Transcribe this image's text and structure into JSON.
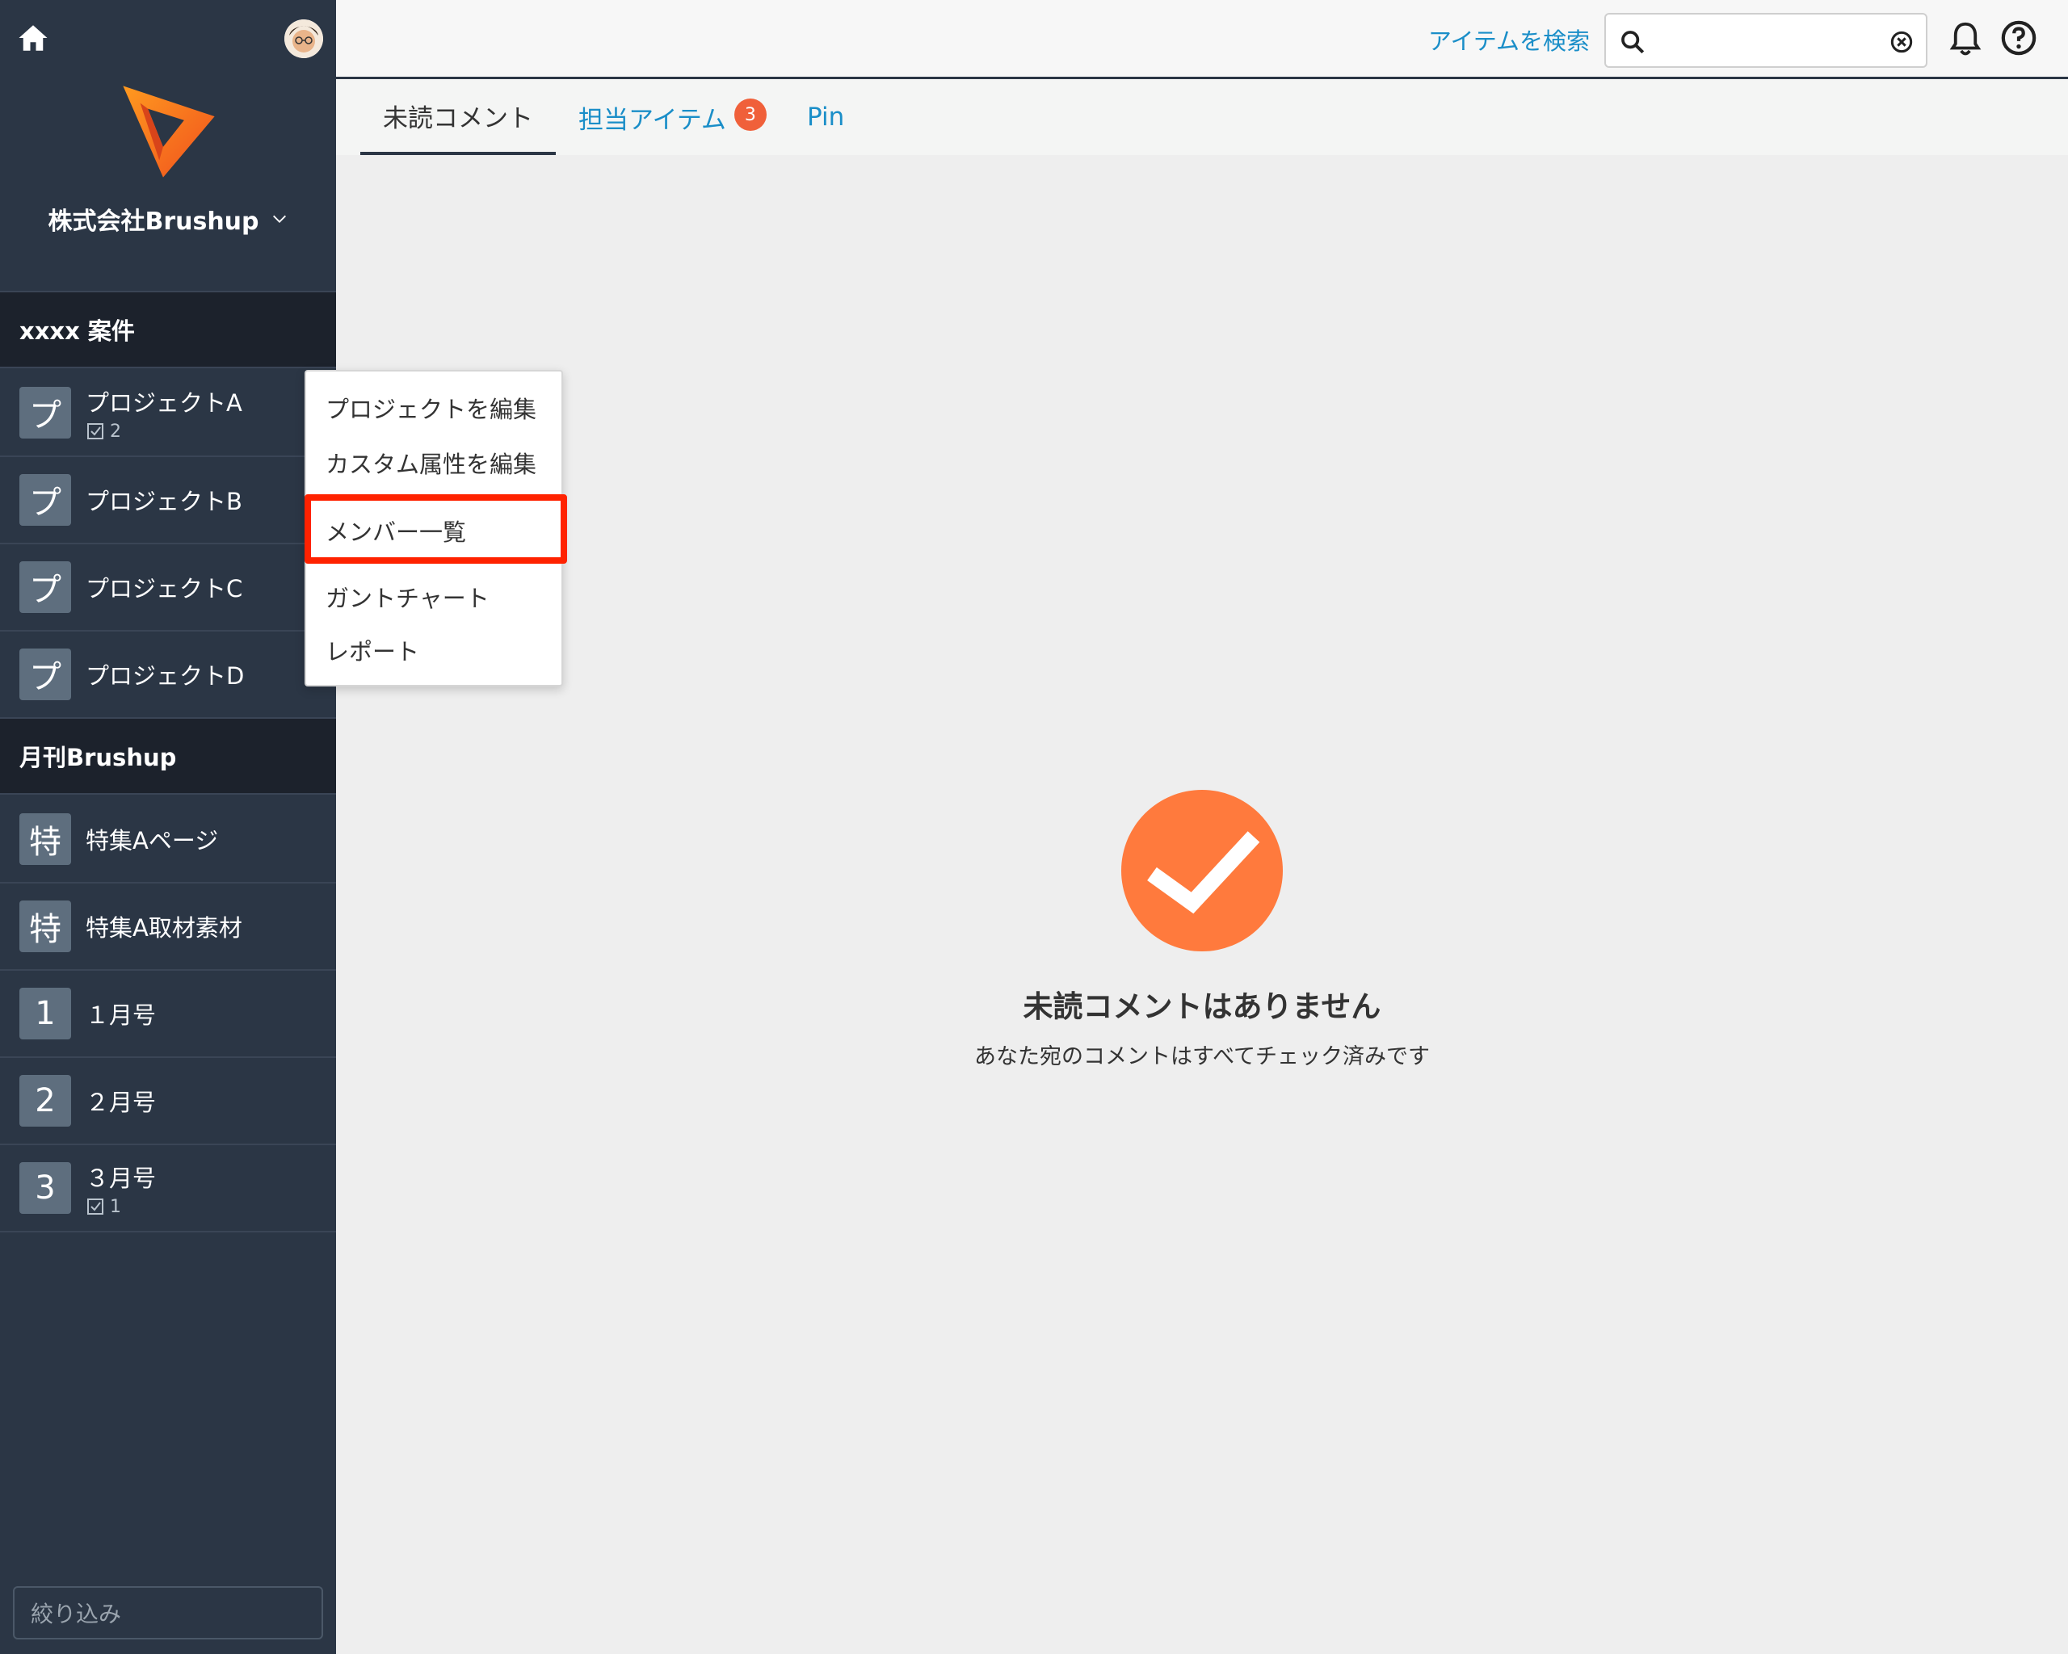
{
  "sidebar": {
    "org_name": "株式会社Brushup",
    "groups": [
      {
        "title": "xxxx 案件",
        "projects": [
          {
            "tile": "プ",
            "name": "プロジェクトA",
            "count": "2"
          },
          {
            "tile": "プ",
            "name": "プロジェクトB",
            "count": ""
          },
          {
            "tile": "プ",
            "name": "プロジェクトC",
            "count": ""
          },
          {
            "tile": "プ",
            "name": "プロジェクトD",
            "count": ""
          }
        ]
      },
      {
        "title": "月刊Brushup",
        "projects": [
          {
            "tile": "特",
            "name": "特集Aページ",
            "count": ""
          },
          {
            "tile": "特",
            "name": "特集A取材素材",
            "count": ""
          },
          {
            "tile": "1",
            "name": "１月号",
            "count": ""
          },
          {
            "tile": "2",
            "name": "２月号",
            "count": ""
          },
          {
            "tile": "3",
            "name": "３月号",
            "count": "1"
          }
        ]
      }
    ],
    "filter_placeholder": "絞り込み"
  },
  "topbar": {
    "search_link": "アイテムを検索",
    "search_value": ""
  },
  "tabs": [
    {
      "label": "未読コメント",
      "active": true
    },
    {
      "label": "担当アイテム",
      "badge": "3"
    },
    {
      "label": "Pin"
    }
  ],
  "context_menu": {
    "items": [
      "プロジェクトを編集",
      "カスタム属性を編集",
      "メンバー一覧",
      "ガントチャート",
      "レポート"
    ],
    "highlighted_index": 2
  },
  "empty_state": {
    "title": "未読コメントはありません",
    "subtitle": "あなた宛のコメントはすべてチェック済みです"
  },
  "colors": {
    "sidebar_bg": "#2b3645",
    "accent_link": "#1a8ec8",
    "badge": "#f0603a",
    "check_circle": "#ff7a3d",
    "highlight_border": "#ff2200"
  }
}
